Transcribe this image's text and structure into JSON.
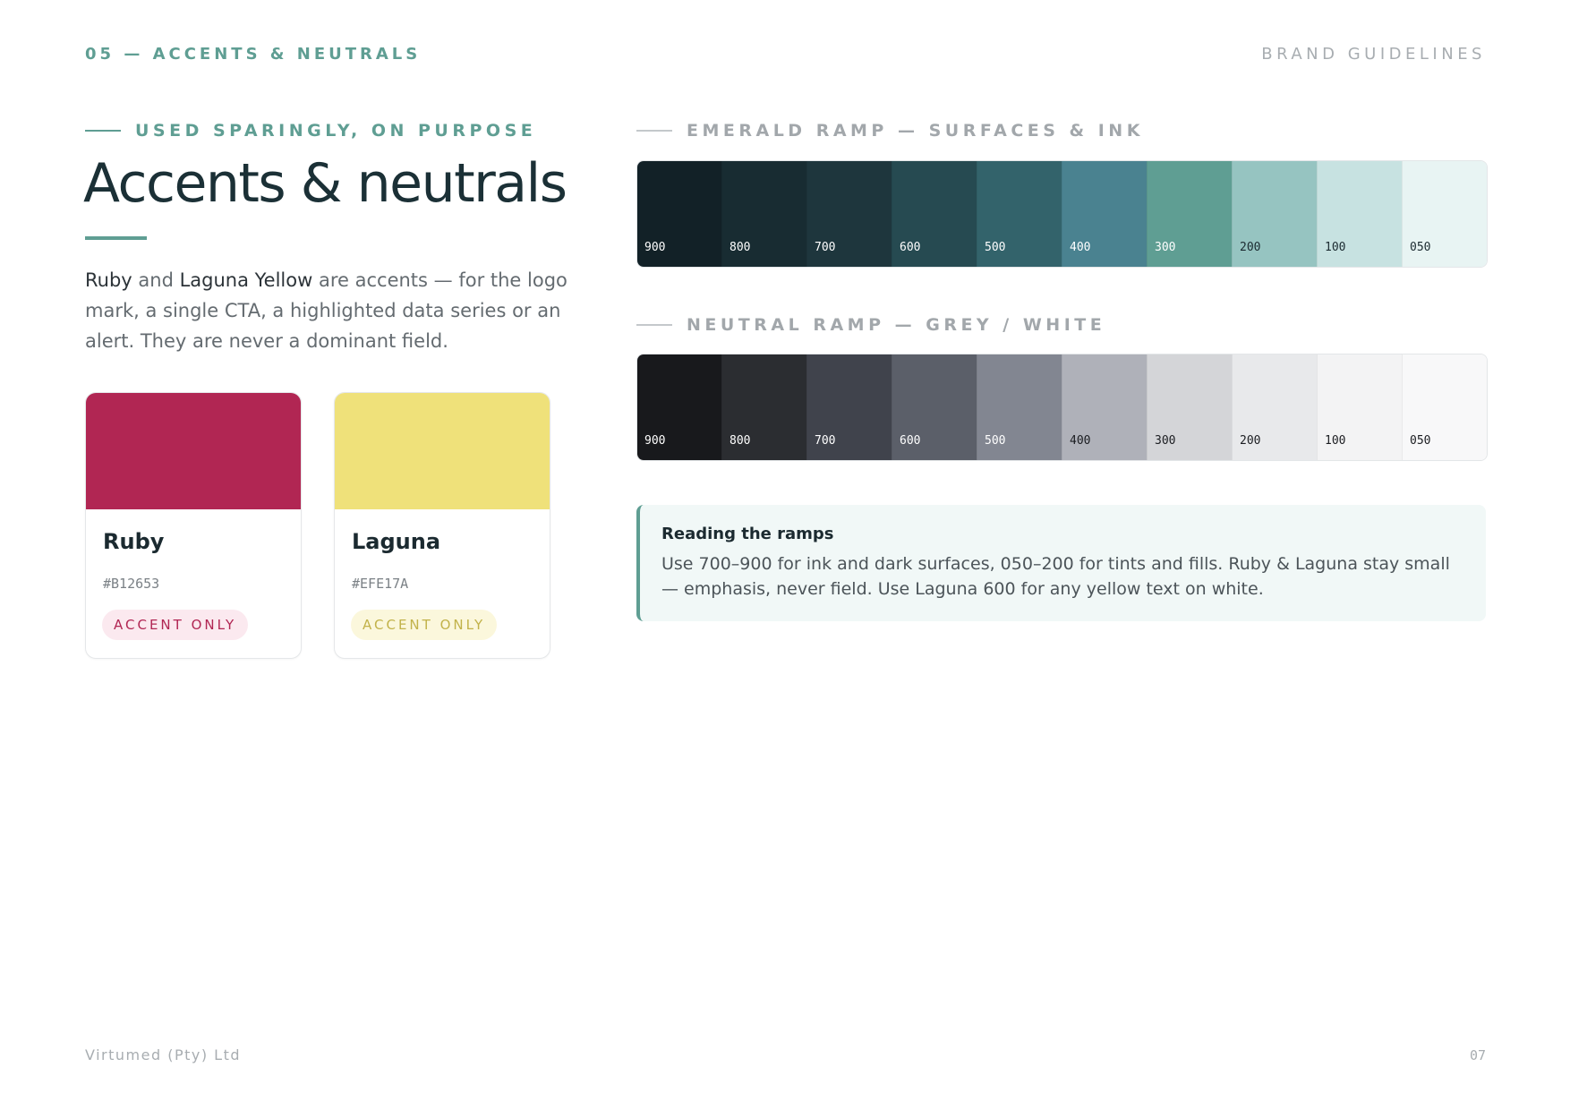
{
  "header": {
    "section_label": "05 — ACCENTS & NEUTRALS",
    "brand_label": "BRAND GUIDELINES"
  },
  "intro": {
    "eyebrow": "USED SPARINGLY, ON PURPOSE",
    "title": "Accents & neutrals",
    "body_ruby": "Ruby",
    "body_and": " and ",
    "body_laguna": "Laguna Yellow",
    "body_rest": " are accents — for the logo mark, a single CTA, a highlighted data series or an alert. They are never a dominant field."
  },
  "accents": [
    {
      "name": "Ruby",
      "hex": "#B12653",
      "badge": "ACCENT ONLY",
      "color": "#B12653",
      "badge_bg": "#fbe9ef",
      "badge_fg": "#b12653"
    },
    {
      "name": "Laguna",
      "hex": "#EFE17A",
      "badge": "ACCENT ONLY",
      "color": "#EFE17A",
      "badge_bg": "#fbf7dc",
      "badge_fg": "#c2b24a"
    }
  ],
  "emerald_ramp": {
    "label": "EMERALD RAMP — SURFACES & INK",
    "steps": [
      {
        "label": "900",
        "color": "#122127",
        "text": "#ffffff"
      },
      {
        "label": "800",
        "color": "#182c32",
        "text": "#ffffff"
      },
      {
        "label": "700",
        "color": "#1e363d",
        "text": "#ffffff"
      },
      {
        "label": "600",
        "color": "#264a51",
        "text": "#ffffff"
      },
      {
        "label": "500",
        "color": "#33636b",
        "text": "#ffffff"
      },
      {
        "label": "400",
        "color": "#4a8290",
        "text": "#ffffff"
      },
      {
        "label": "300",
        "color": "#5f9e93",
        "text": "#ffffff"
      },
      {
        "label": "200",
        "color": "#96c4c1",
        "text": "#1b2a30"
      },
      {
        "label": "100",
        "color": "#c7e2e1",
        "text": "#1b2a30"
      },
      {
        "label": "050",
        "color": "#e8f4f3",
        "text": "#1b2a30"
      }
    ]
  },
  "neutral_ramp": {
    "label": "NEUTRAL RAMP — GREY / WHITE",
    "steps": [
      {
        "label": "900",
        "color": "#18191c",
        "text": "#ffffff"
      },
      {
        "label": "800",
        "color": "#2b2d31",
        "text": "#ffffff"
      },
      {
        "label": "700",
        "color": "#40434c",
        "text": "#ffffff"
      },
      {
        "label": "600",
        "color": "#5b5f69",
        "text": "#ffffff"
      },
      {
        "label": "500",
        "color": "#828691",
        "text": "#ffffff"
      },
      {
        "label": "400",
        "color": "#afb1b9",
        "text": "#1b1d21"
      },
      {
        "label": "300",
        "color": "#d4d5d8",
        "text": "#1b1d21"
      },
      {
        "label": "200",
        "color": "#e8e9eb",
        "text": "#1b1d21"
      },
      {
        "label": "100",
        "color": "#f3f3f4",
        "text": "#1b1d21"
      },
      {
        "label": "050",
        "color": "#f8f8f9",
        "text": "#1b1d21"
      }
    ]
  },
  "note": {
    "title": "Reading the ramps",
    "body": "Use 700–900 for ink and dark surfaces, 050–200 for tints and fills. Ruby & Laguna stay small — emphasis, never field. Use Laguna 600 for any yellow text on white."
  },
  "footer": {
    "company": "Virtumed (Pty) Ltd",
    "page_number": "07"
  }
}
